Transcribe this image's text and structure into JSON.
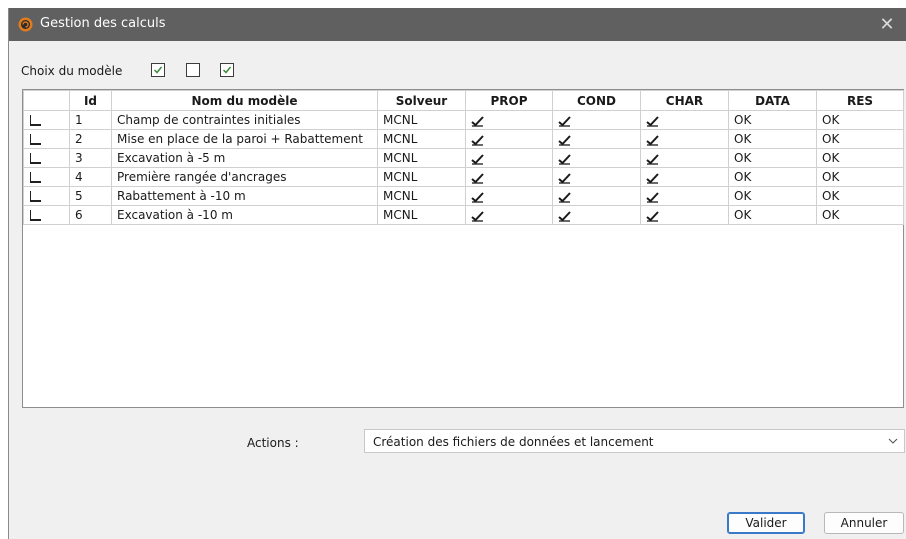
{
  "window": {
    "title": "Gestion des calculs"
  },
  "model_choice": {
    "label": "Choix du modèle",
    "checkboxes": [
      true,
      false,
      true
    ]
  },
  "table": {
    "columns": [
      "",
      "Id",
      "Nom du modèle",
      "Solveur",
      "PROP",
      "COND",
      "CHAR",
      "DATA",
      "RES"
    ],
    "rows": [
      {
        "selected": false,
        "id": "1",
        "name": "Champ de contraintes initiales",
        "solver": "MCNL",
        "prop": true,
        "cond": true,
        "char": true,
        "data": "OK",
        "res": "OK"
      },
      {
        "selected": false,
        "id": "2",
        "name": "Mise en place de la paroi + Rabattement",
        "solver": "MCNL",
        "prop": true,
        "cond": true,
        "char": true,
        "data": "OK",
        "res": "OK"
      },
      {
        "selected": false,
        "id": "3",
        "name": "Excavation à -5 m",
        "solver": "MCNL",
        "prop": true,
        "cond": true,
        "char": true,
        "data": "OK",
        "res": "OK"
      },
      {
        "selected": false,
        "id": "4",
        "name": "Première rangée d'ancrages",
        "solver": "MCNL",
        "prop": true,
        "cond": true,
        "char": true,
        "data": "OK",
        "res": "OK"
      },
      {
        "selected": false,
        "id": "5",
        "name": "Rabattement à -10 m",
        "solver": "MCNL",
        "prop": true,
        "cond": true,
        "char": true,
        "data": "OK",
        "res": "OK"
      },
      {
        "selected": false,
        "id": "6",
        "name": "Excavation à -10 m",
        "solver": "MCNL",
        "prop": true,
        "cond": true,
        "char": true,
        "data": "OK",
        "res": "OK"
      }
    ]
  },
  "actions": {
    "label": "Actions :",
    "selected": "Création des fichiers de données et lancement"
  },
  "buttons": {
    "validate": "Valider",
    "cancel": "Annuler"
  },
  "colors": {
    "titlebar": "#606060",
    "checkbox_tick": "#3a8a3a",
    "primary_border": "#3a78c8"
  },
  "icons": {
    "app": "app-logo-icon",
    "close": "close-icon",
    "dropdown": "chevron-down-icon"
  }
}
